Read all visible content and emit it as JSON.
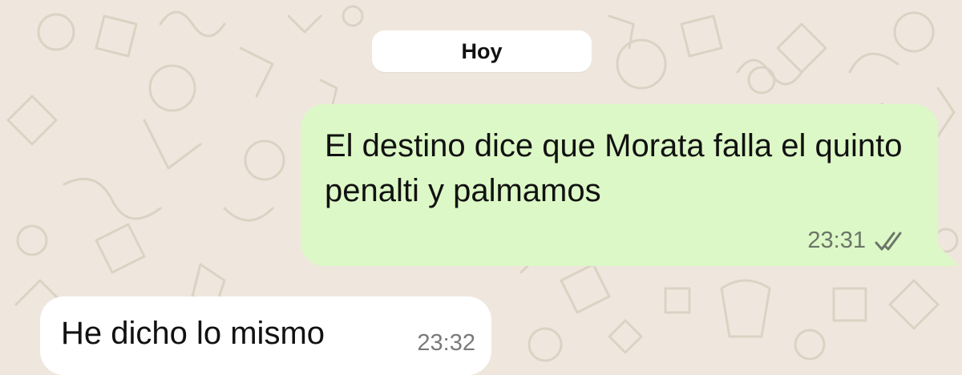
{
  "chat": {
    "date_label": "Hoy",
    "messages": [
      {
        "direction": "outgoing",
        "text": "El destino dice que Morata falla el quinto penalti y palmamos",
        "time": "23:31",
        "status": "read"
      },
      {
        "direction": "incoming",
        "text": "He dicho lo mismo",
        "time": "23:32"
      }
    ]
  },
  "colors": {
    "background": "#efe7dd",
    "outgoing_bubble": "#dcf8c6",
    "incoming_bubble": "#ffffff",
    "read_ticks": "#6b7569"
  }
}
